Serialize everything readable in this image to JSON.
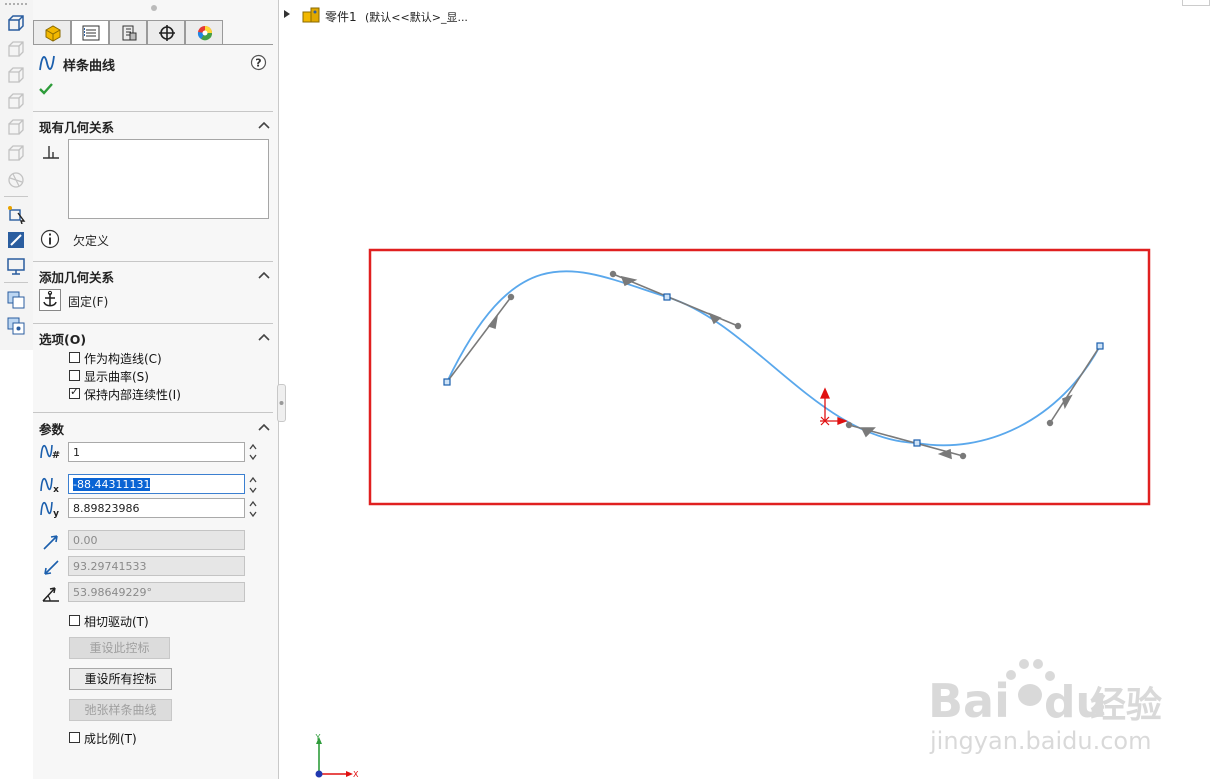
{
  "tree": {
    "part_label": "零件1",
    "config_label": "(默认<<默认>_显..."
  },
  "pm": {
    "title": "样条曲线",
    "help_icon": "help-icon",
    "existing_relations": {
      "title": "现有几何关系",
      "status": "欠定义"
    },
    "add_relations": {
      "title": "添加几何关系",
      "fixed_label": "固定(F)"
    },
    "options": {
      "title": "选项(O)",
      "items": [
        {
          "label": "作为构造线(C)",
          "checked": false
        },
        {
          "label": "显示曲率(S)",
          "checked": false
        },
        {
          "label": "保持内部连续性(I)",
          "checked": true
        }
      ]
    },
    "params": {
      "title": "参数",
      "point_index": "1",
      "x_value": "-88.44311131",
      "y_value": "8.89823986",
      "tangent_weight_1": "0.00",
      "tangent_weight_2": "93.29741533",
      "tangent_angle": "53.98649229°",
      "tangent_driving_label": "相切驱动(T)",
      "tangent_driving_checked": false,
      "reset_this_handle": "重设此控标",
      "reset_all_handles": "重设所有控标",
      "relax_spline": "弛张样条曲线",
      "proportional_label": "成比例(T)",
      "proportional_checked": false
    }
  },
  "colors": {
    "spline": "#5aa8ec",
    "highlight_box": "#e02020",
    "handle": "#7a7a7a",
    "origin_red": "#e01010",
    "selection": "#0a64d4"
  },
  "watermark": {
    "brand": "Bai",
    "brand2": "du",
    "cn": "经验",
    "url": "jingyan.baidu.com"
  },
  "axes": {
    "x": "X",
    "y": "Y"
  }
}
